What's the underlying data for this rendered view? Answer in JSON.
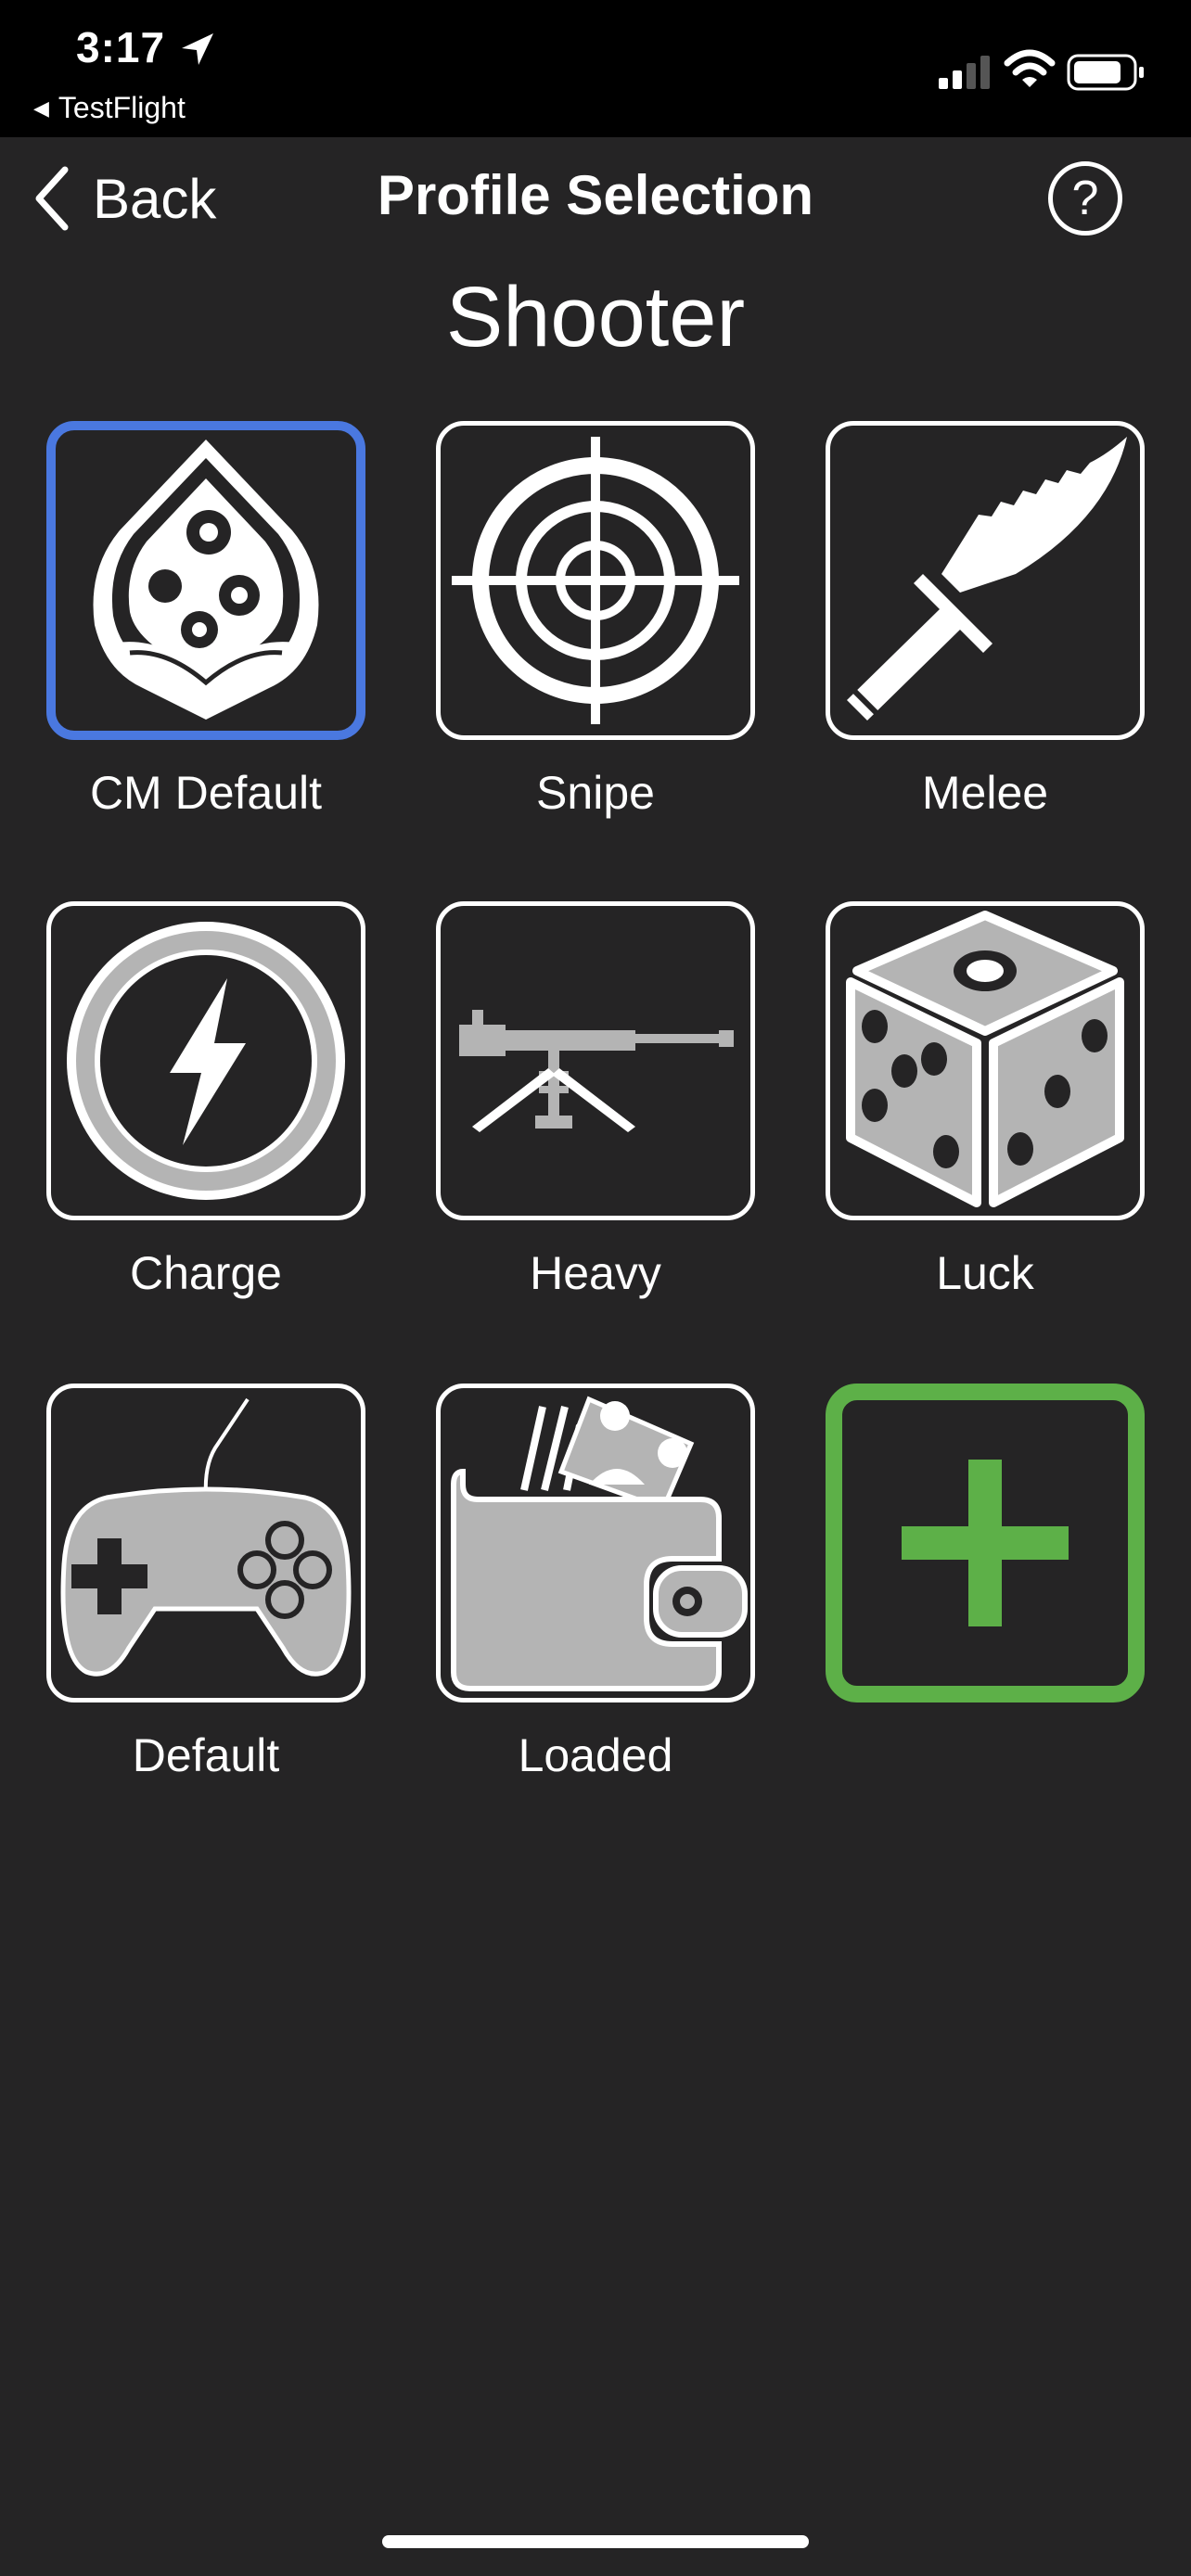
{
  "status": {
    "time": "3:17",
    "back_app": "TestFlight",
    "icons": [
      "location-arrow-icon",
      "signal-icon",
      "wifi-icon",
      "battery-icon"
    ]
  },
  "nav": {
    "back_label": "Back",
    "title": "Profile Selection",
    "help_label": "?"
  },
  "section_title": "Shooter",
  "profiles": [
    {
      "label": "CM Default",
      "icon": "droplet-gears-icon",
      "selected": true
    },
    {
      "label": "Snipe",
      "icon": "crosshair-icon"
    },
    {
      "label": "Melee",
      "icon": "knife-icon"
    },
    {
      "label": "Charge",
      "icon": "lightning-icon"
    },
    {
      "label": "Heavy",
      "icon": "mounted-gun-icon"
    },
    {
      "label": "Luck",
      "icon": "dice-icon"
    },
    {
      "label": "Default",
      "icon": "gamepad-icon"
    },
    {
      "label": "Loaded",
      "icon": "wallet-icon"
    }
  ],
  "add_profile": {
    "icon": "plus-icon"
  },
  "colors": {
    "background": "#252425",
    "selected_border": "#4a78e0",
    "add_accent": "#5db048",
    "icon_gray": "#b4b4b4"
  }
}
